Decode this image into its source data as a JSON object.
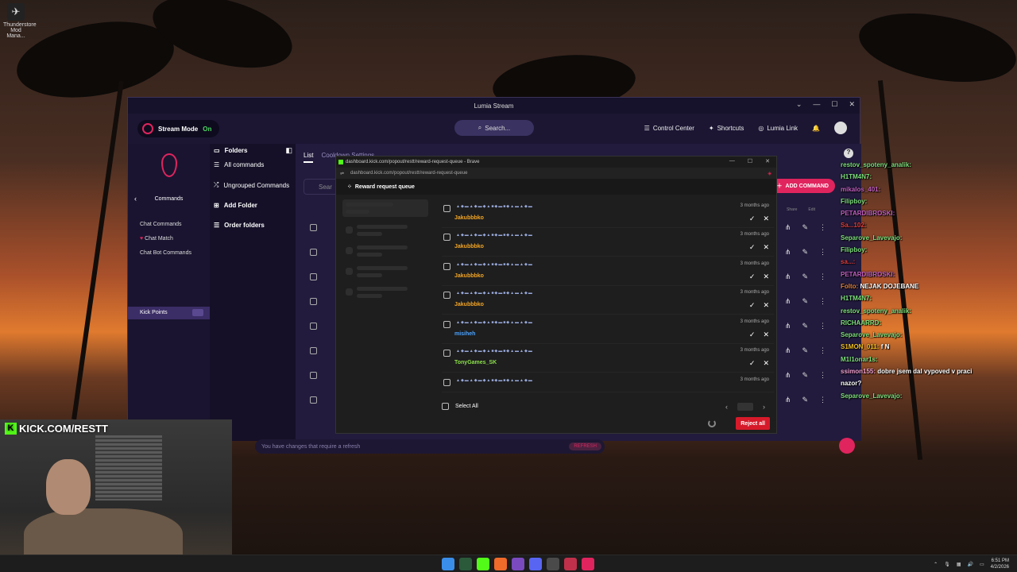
{
  "desktop": {
    "icon_label": "Thunderstore Mod Mana..."
  },
  "lumia": {
    "title": "Lumia Stream",
    "stream_mode": {
      "label": "Stream Mode",
      "state": "On"
    },
    "search_label": "Search...",
    "top_links": [
      "Control Center",
      "Shortcuts",
      "Lumia Link"
    ],
    "nav": {
      "section": "Commands",
      "items": [
        "Chat Commands",
        "Chat Match",
        "Chat Bot Commands",
        "Kick Points"
      ],
      "active": "Kick Points"
    },
    "folders": {
      "header": "Folders",
      "items": [
        "All commands",
        "Ungrouped Commands",
        "Add Folder",
        "Order folders"
      ]
    },
    "tabs": [
      "List",
      "Cooldown Settings"
    ],
    "search_placeholder": "Sear",
    "add_command": "ADD COMMAND",
    "column_headers": [
      "Share",
      "Edit"
    ],
    "refresh_bar": {
      "text": "You have changes that require a refresh",
      "button": "REFRESH"
    }
  },
  "popup": {
    "title": "dashboard.kick.com/popout/restt/reward-request-queue - Brave",
    "url": "dashboard.kick.com/popout/restt/reward-request-queue",
    "header": "Reward request queue",
    "requests": [
      {
        "user": "Jakubbbko",
        "time": "3 months ago",
        "color": "#f5a623"
      },
      {
        "user": "Jakubbbko",
        "time": "3 months ago",
        "color": "#f5a623"
      },
      {
        "user": "Jakubbbko",
        "time": "3 months ago",
        "color": "#f5a623"
      },
      {
        "user": "Jakubbbko",
        "time": "3 months ago",
        "color": "#f5a623"
      },
      {
        "user": "misiheh",
        "time": "3 months ago",
        "color": "#4aa3ff"
      },
      {
        "user": "TonyGames_SK",
        "time": "3 months ago",
        "color": "#8be04a"
      },
      {
        "user": "",
        "time": "3 months ago",
        "color": "#d08ad0"
      }
    ],
    "select_all": "Select All",
    "reject_all": "Reject all"
  },
  "chat": [
    {
      "user": "restov_spoteny_analik:",
      "msg": "",
      "color": "#7ee07e"
    },
    {
      "user": "H1TM4N7:",
      "msg": "",
      "color": "#7ee07e"
    },
    {
      "user": "mikalos_401:",
      "msg": "",
      "color": "#c060c0"
    },
    {
      "user": "Filipboy:",
      "msg": "",
      "color": "#7ee07e"
    },
    {
      "user": "PETARDIBROSKI:",
      "msg": "",
      "color": "#c060c0"
    },
    {
      "user": "Sa...102:",
      "msg": "",
      "color": "#e04040"
    },
    {
      "user": "Separove_Lavevajo:",
      "msg": "",
      "color": "#7ee07e"
    },
    {
      "user": "Filipboy:",
      "msg": "",
      "color": "#7ee07e"
    },
    {
      "user": "sa...:",
      "msg": "",
      "color": "#e04040"
    },
    {
      "user": "PETARDIBROSKI:",
      "msg": "",
      "color": "#c060c0"
    },
    {
      "user": "Folto:",
      "msg": "NEJAK DOJEBANE",
      "color": "#e08040"
    },
    {
      "user": "H1TM4N7:",
      "msg": "",
      "color": "#7ee07e"
    },
    {
      "user": "restov_spoteny_analik:",
      "msg": "",
      "color": "#7ee07e"
    },
    {
      "user": "RICHAARRD:",
      "msg": "",
      "color": "#7ee07e"
    },
    {
      "user": "Separove_Lavevajo:",
      "msg": "",
      "color": "#7ee07e"
    },
    {
      "user": "S1MON_011:",
      "msg": "f N",
      "color": "#f0c020"
    },
    {
      "user": "M1l1onar1s:",
      "msg": "",
      "color": "#7ee07e"
    },
    {
      "user": "ssimon155:",
      "msg": "dobre jsem dal vypoved v praci",
      "color": "#f0a0d0"
    },
    {
      "user": "",
      "msg": "nazor?",
      "color": "#ffffff"
    },
    {
      "user": "Separove_Lavevajo:",
      "msg": "",
      "color": "#7ee07e"
    }
  ],
  "webcam": {
    "banner": "KICK.COM/RESTT"
  },
  "taskbar": {
    "time": "6:51 PM",
    "date": "4/2/2026"
  }
}
